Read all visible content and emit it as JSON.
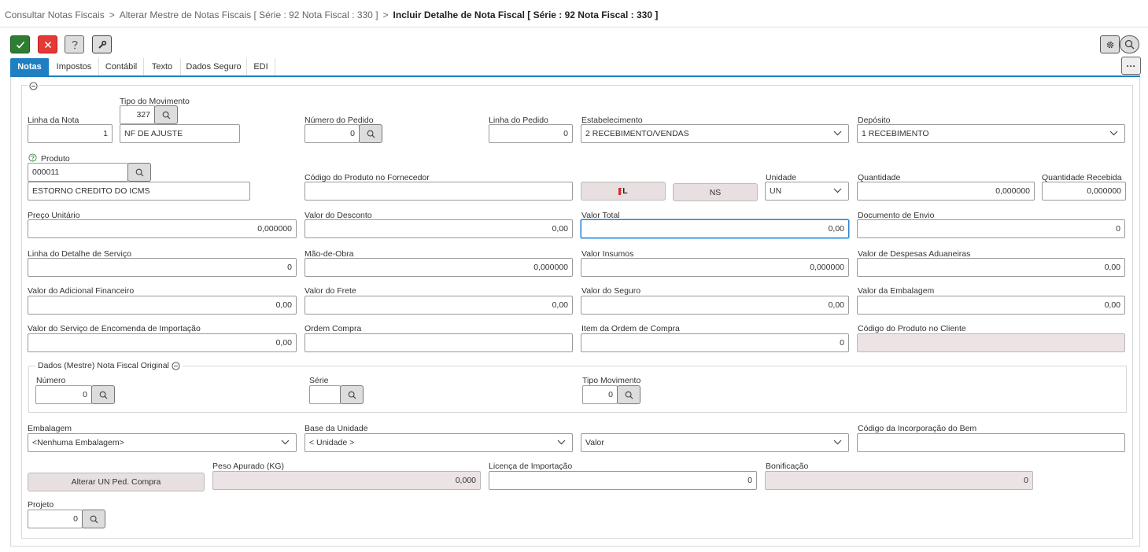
{
  "breadcrumb": {
    "item1": "Consultar Notas Fiscais",
    "item2": "Alterar Mestre de Notas Fiscais [ Série : 92 Nota Fiscal : 330 ]",
    "current": "Incluir Detalhe de Nota Fiscal [ Série : 92 Nota Fiscal : 330 ]",
    "separator": ">"
  },
  "toolbar": {
    "confirm_icon": "check-icon",
    "cancel_icon": "close-icon",
    "help_icon": "question-icon",
    "tools_icon": "wrench-icon",
    "settings_icon": "gear-icon",
    "search_icon": "search-icon",
    "more_label": "···",
    "colors": {
      "confirm": "#2e7d32",
      "cancel": "#e53935",
      "accent": "#1e7fc3"
    }
  },
  "tabs": [
    "Notas",
    "Impostos",
    "Contábil",
    "Texto",
    "Dados Seguro",
    "EDI"
  ],
  "collapse_icon": "minus-circle-icon",
  "form": {
    "linha_nota": {
      "label": "Linha da Nota",
      "value": "1"
    },
    "tipo_movimento": {
      "label": "Tipo do Movimento",
      "code": "327",
      "desc": "NF DE AJUSTE"
    },
    "numero_pedido": {
      "label": "Número do Pedido",
      "value": "0"
    },
    "linha_pedido": {
      "label": "Linha do Pedido",
      "value": "0"
    },
    "estabelecimento": {
      "label": "Estabelecimento",
      "value": "2 RECEBIMENTO/VENDAS"
    },
    "deposito": {
      "label": "Depósito",
      "value": "1 RECEBIMENTO"
    },
    "produto": {
      "label": "Produto",
      "code": "000011",
      "desc": "ESTORNO CREDITO DO ICMS"
    },
    "codigo_fornecedor": {
      "label": "Código do Produto no Fornecedor",
      "value": ""
    },
    "btn_l": "L",
    "btn_ns": "NS",
    "unidade": {
      "label": "Unidade",
      "value": "UN"
    },
    "quantidade": {
      "label": "Quantidade",
      "value": "0,000000"
    },
    "quantidade_recebida": {
      "label": "Quantidade Recebida",
      "value": "0,000000"
    },
    "preco_unitario": {
      "label": "Preço Unitário",
      "value": "0,000000"
    },
    "valor_desconto": {
      "label": "Valor do Desconto",
      "value": "0,00"
    },
    "valor_total": {
      "label": "Valor Total",
      "value": "0,00"
    },
    "documento_envio": {
      "label": "Documento de Envio",
      "value": "0"
    },
    "linha_servico": {
      "label": "Linha do Detalhe de Serviço",
      "value": "0"
    },
    "mao_obra": {
      "label": "Mão-de-Obra",
      "value": "0,000000"
    },
    "valor_insumos": {
      "label": "Valor Insumos",
      "value": "0,000000"
    },
    "despesas_aduaneiras": {
      "label": "Valor de Despesas Aduaneiras",
      "value": "0,00"
    },
    "adicional_financeiro": {
      "label": "Valor do Adicional Financeiro",
      "value": "0,00"
    },
    "valor_frete": {
      "label": "Valor do Frete",
      "value": "0,00"
    },
    "valor_seguro": {
      "label": "Valor do Seguro",
      "value": "0,00"
    },
    "valor_embalagem": {
      "label": "Valor da Embalagem",
      "value": "0,00"
    },
    "servico_importacao": {
      "label": "Valor do Serviço de Encomenda de Importação",
      "value": "0,00"
    },
    "ordem_compra": {
      "label": "Ordem Compra",
      "value": ""
    },
    "item_ordem_compra": {
      "label": "Item da Ordem de Compra",
      "value": "0"
    },
    "codigo_cliente": {
      "label": "Código do Produto no Cliente",
      "value": ""
    },
    "nf_original": {
      "title": "Dados (Mestre) Nota Fiscal Original",
      "numero": {
        "label": "Número",
        "value": "0"
      },
      "serie": {
        "label": "Série",
        "value": ""
      },
      "tipo_movimento": {
        "label": "Tipo Movimento",
        "value": "0"
      }
    },
    "embalagem": {
      "label": "Embalagem",
      "value": "<Nenhuma Embalagem>"
    },
    "base_unidade": {
      "label": "Base da Unidade",
      "value": "< Unidade >"
    },
    "valor_select": {
      "value": "Valor"
    },
    "incorporacao_bem": {
      "label": "Código da Incorporação do Bem",
      "value": ""
    },
    "alterar_un_btn": "Alterar UN Ped. Compra",
    "peso_apurado": {
      "label": "Peso Apurado (KG)",
      "value": "0,000"
    },
    "licenca_importacao": {
      "label": "Licença de Importação",
      "value": "0"
    },
    "bonificacao": {
      "label": "Bonificação",
      "value": "0"
    },
    "projeto": {
      "label": "Projeto",
      "value": "0"
    }
  }
}
